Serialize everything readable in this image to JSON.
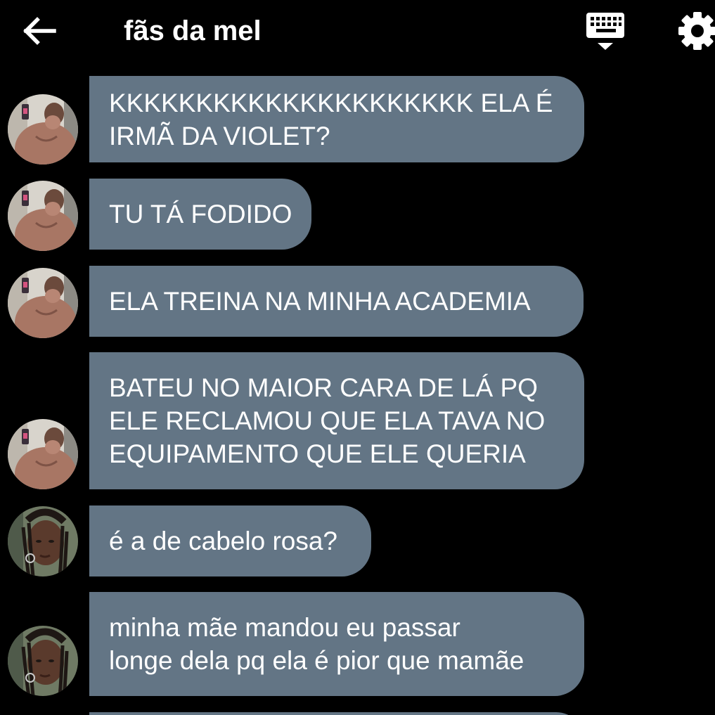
{
  "header": {
    "title": "fãs da mel",
    "icons": {
      "back": "arrow-left-icon",
      "keyboard": "keyboard-icon",
      "settings": "gear-icon"
    }
  },
  "colors": {
    "background": "#000000",
    "bubble": "#637585",
    "text": "#ffffff"
  },
  "messages": [
    {
      "sender": "user-a",
      "lines": [
        "KKKKKKKKKKKKKKKKKKKKK ELA É",
        "IRMÃ DA VIOLET?"
      ]
    },
    {
      "sender": "user-a",
      "lines": [
        "TU TÁ FODIDO"
      ]
    },
    {
      "sender": "user-a",
      "lines": [
        "ELA TREINA NA MINHA ACADEMIA"
      ]
    },
    {
      "sender": "user-a",
      "lines": [
        "BATEU NO MAIOR CARA DE LÁ PQ",
        "ELE RECLAMOU QUE ELA TAVA NO",
        "EQUIPAMENTO QUE ELE QUERIA"
      ]
    },
    {
      "sender": "user-b",
      "lines": [
        "é a de cabelo rosa?"
      ]
    },
    {
      "sender": "user-b",
      "lines": [
        "minha mãe mandou eu passar",
        "longe dela pq ela é pior que mamãe"
      ]
    }
  ]
}
